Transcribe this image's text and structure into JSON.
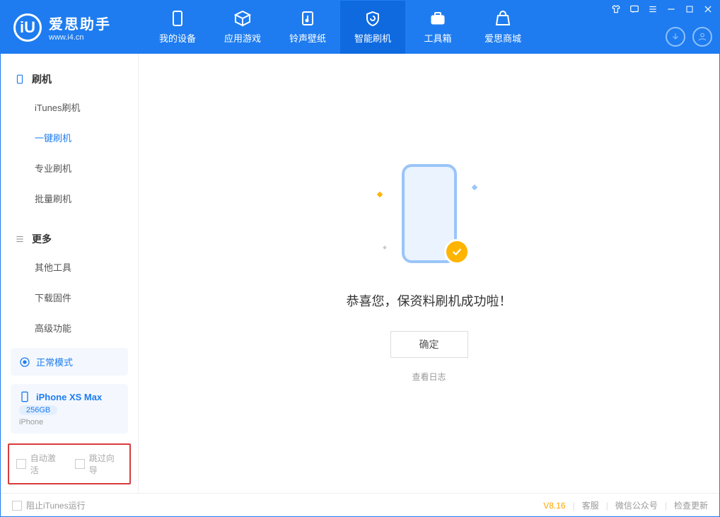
{
  "app": {
    "title": "爱思助手",
    "url": "www.i4.cn"
  },
  "nav": {
    "tabs": [
      {
        "label": "我的设备"
      },
      {
        "label": "应用游戏"
      },
      {
        "label": "铃声壁纸"
      },
      {
        "label": "智能刷机"
      },
      {
        "label": "工具箱"
      },
      {
        "label": "爱思商城"
      }
    ]
  },
  "sidebar": {
    "section1": {
      "title": "刷机",
      "items": [
        "iTunes刷机",
        "一键刷机",
        "专业刷机",
        "批量刷机"
      ]
    },
    "section2": {
      "title": "更多",
      "items": [
        "其他工具",
        "下载固件",
        "高级功能"
      ]
    },
    "mode": "正常模式",
    "device": {
      "name": "iPhone XS Max",
      "capacity": "256GB",
      "type": "iPhone"
    },
    "checks": {
      "autoactivate": "自动激活",
      "skipwizard": "跳过向导"
    }
  },
  "main": {
    "success": "恭喜您，保资料刷机成功啦！",
    "ok": "确定",
    "log": "查看日志"
  },
  "footer": {
    "block_itunes": "阻止iTunes运行",
    "version": "V8.16",
    "links": [
      "客服",
      "微信公众号",
      "检查更新"
    ]
  }
}
